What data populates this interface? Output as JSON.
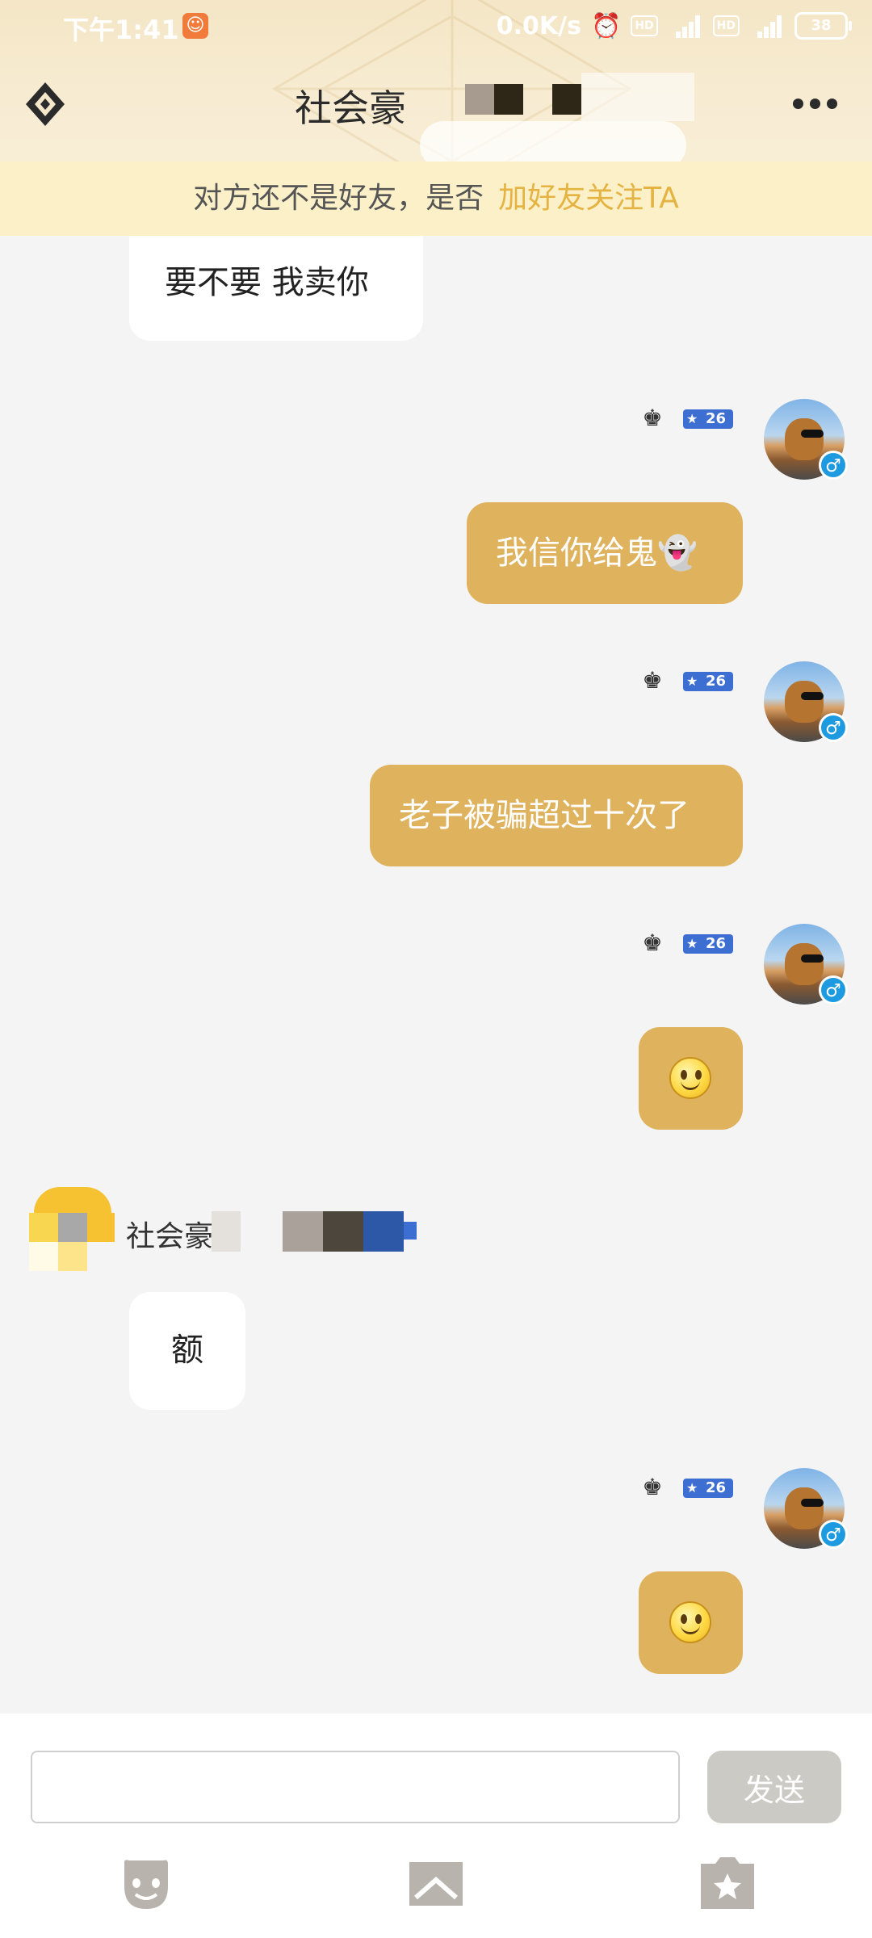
{
  "status_bar": {
    "time": "下午1:41",
    "speed": "0.0K/s",
    "hd1": "HD",
    "hd2": "HD",
    "net1": "4G",
    "net2": "4G",
    "battery": "38"
  },
  "header": {
    "title": "社会豪"
  },
  "banner": {
    "text": "对方还不是好友，是否",
    "link": "加好友关注TA"
  },
  "messages": [
    {
      "side": "in",
      "text": "要不要 我卖你"
    },
    {
      "side": "out",
      "text": "我信你给鬼👻",
      "level": "26"
    },
    {
      "side": "out",
      "text": "老子被骗超过十次了",
      "level": "26"
    },
    {
      "side": "out",
      "emoji": "smile-icon",
      "level": "26"
    },
    {
      "side": "in",
      "sender": "社会豪",
      "text": "额"
    },
    {
      "side": "out",
      "emoji": "smile-icon",
      "level": "26"
    }
  ],
  "input": {
    "value": "",
    "send_label": "发送"
  },
  "toolbar": [
    "face-icon",
    "image-icon",
    "gift-icon"
  ],
  "colors": {
    "accent": "#dfb25e",
    "link": "#e5b342",
    "banner_bg": "#fbf0c8",
    "level_badge": "#3d6fd3"
  }
}
